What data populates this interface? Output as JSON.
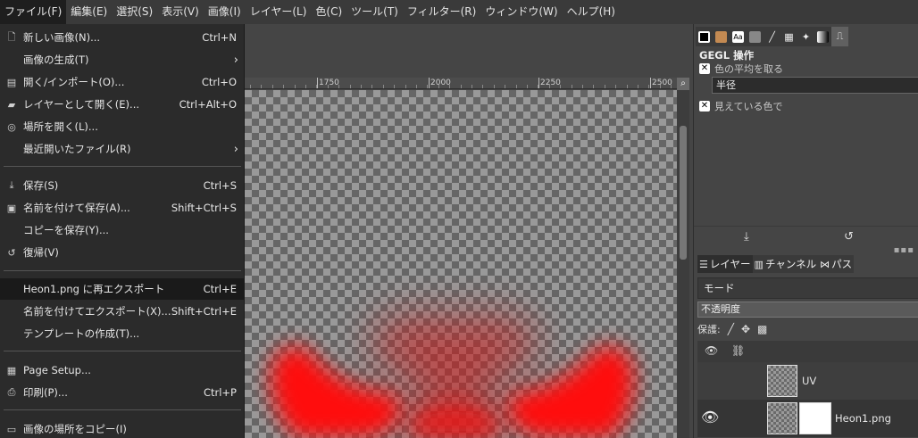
{
  "menubar": {
    "items": [
      "ファイル(F)",
      "編集(E)",
      "選択(S)",
      "表示(V)",
      "画像(I)",
      "レイヤー(L)",
      "色(C)",
      "ツール(T)",
      "フィルター(R)",
      "ウィンドウ(W)",
      "ヘルプ(H)"
    ]
  },
  "file_menu": {
    "items": [
      {
        "icon": "new-image-icon",
        "glyph": "🗋",
        "label": "新しい画像(N)...",
        "accel": "Ctrl+N",
        "submenu": false
      },
      {
        "icon": "",
        "glyph": "",
        "label": "画像の生成(T)",
        "accel": "",
        "submenu": true
      },
      {
        "icon": "open-icon",
        "glyph": "▤",
        "label": "開く/インポート(O)...",
        "accel": "Ctrl+O",
        "submenu": false
      },
      {
        "icon": "open-as-layers-icon",
        "glyph": "▰",
        "label": "レイヤーとして開く(E)...",
        "accel": "Ctrl+Alt+O",
        "submenu": false
      },
      {
        "icon": "open-location-icon",
        "glyph": "◎",
        "label": "場所を開く(L)...",
        "accel": "",
        "submenu": false
      },
      {
        "icon": "",
        "glyph": "",
        "label": "最近開いたファイル(R)",
        "accel": "",
        "submenu": true
      },
      {
        "icon": "save-icon",
        "glyph": "⤓",
        "label": "保存(S)",
        "accel": "Ctrl+S",
        "submenu": false
      },
      {
        "icon": "save-as-icon",
        "glyph": "▣",
        "label": "名前を付けて保存(A)...",
        "accel": "Shift+Ctrl+S",
        "submenu": false
      },
      {
        "icon": "",
        "glyph": "",
        "label": "コピーを保存(Y)...",
        "accel": "",
        "submenu": false
      },
      {
        "icon": "revert-icon",
        "glyph": "↺",
        "label": "復帰(V)",
        "accel": "",
        "submenu": false
      },
      {
        "icon": "",
        "glyph": "",
        "label": "Heon1.png に再エクスポート",
        "accel": "Ctrl+E",
        "submenu": false
      },
      {
        "icon": "",
        "glyph": "",
        "label": "名前を付けてエクスポート(X)...",
        "accel": "Shift+Ctrl+E",
        "submenu": false
      },
      {
        "icon": "",
        "glyph": "",
        "label": "テンプレートの作成(T)...",
        "accel": "",
        "submenu": false
      },
      {
        "icon": "page-setup-icon",
        "glyph": "▦",
        "label": "Page Setup...",
        "accel": "",
        "submenu": false
      },
      {
        "icon": "print-icon",
        "glyph": "⎙",
        "label": "印刷(P)...",
        "accel": "Ctrl+P",
        "submenu": false
      },
      {
        "icon": "copy-location-icon",
        "glyph": "▭",
        "label": "画像の場所をコピー(I)",
        "accel": "",
        "submenu": false
      }
    ]
  },
  "ruler": {
    "labels": [
      "1750",
      "2000",
      "2250",
      "2500"
    ]
  },
  "gegl": {
    "title": "GEGL 操作",
    "sample_average": "色の平均を取る",
    "radius_label": "半径",
    "sample_merged": "見えている色で"
  },
  "dock_tabs": {
    "layers": "レイヤー",
    "channels": "チャンネル",
    "paths": "パス"
  },
  "layers_panel": {
    "mode_label": "モード",
    "opacity_label": "不透明度",
    "lock_label": "保護:",
    "layers": [
      {
        "name": "UV",
        "visible": false
      },
      {
        "name": "Heon1.png",
        "visible": true
      }
    ]
  },
  "colors": {
    "highlight": "#1a1a1a",
    "paint_red": "#ff0000"
  }
}
